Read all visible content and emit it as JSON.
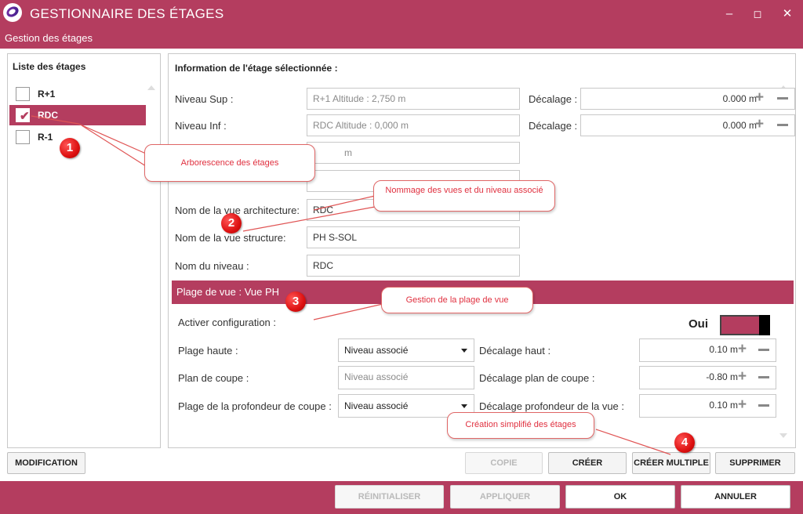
{
  "window": {
    "title": "GESTIONNAIRE DES ÉTAGES",
    "subtitle": "Gestion des étages",
    "minimize": "–",
    "maximize": "◻",
    "close": "✕"
  },
  "left_panel": {
    "title": "Liste des étages",
    "floors": [
      {
        "label": "R+1",
        "checked": false,
        "selected": false
      },
      {
        "label": "RDC",
        "checked": true,
        "selected": true
      },
      {
        "label": "R-1",
        "checked": false,
        "selected": false
      }
    ],
    "checkmark": "✔"
  },
  "info": {
    "title": "Information de l'étage sélectionnée :",
    "niveau_sup_label": "Niveau Sup :",
    "niveau_sup_value": "R+1  Altitude : 2,750 m",
    "decalage_label": "Décalage :",
    "decalage_sup_value": "0.000 m",
    "niveau_inf_label": "Niveau Inf :",
    "niveau_inf_value": "RDC  Altitude : 0,000 m",
    "decalage_inf_value": "0.000 m",
    "hidden_field_value": "m",
    "vue_archi_label": "Nom de la vue architecture:",
    "vue_archi_value": "RDC",
    "vue_structure_label": "Nom de la vue structure:",
    "vue_structure_value": "PH S-SOL",
    "niveau_label": "Nom du niveau :",
    "niveau_value": "RDC"
  },
  "plage": {
    "header": "Plage de vue : Vue PH",
    "activer_label": "Activer configuration :",
    "toggle_label": "Oui",
    "plage_haute_label": "Plage haute :",
    "plage_haute_value": "Niveau associé",
    "plan_coupe_label": "Plan de coupe :",
    "plan_coupe_value": "Niveau associé",
    "profondeur_label": "Plage de la profondeur de coupe :",
    "profondeur_value": "Niveau associé",
    "decalage_haut_label": "Décalage haut :",
    "decalage_haut_value": "0.10 m",
    "decalage_plan_label": "Décalage plan de coupe :",
    "decalage_plan_value": "-0.80 m",
    "decalage_prof_label": "Décalage profondeur de la vue :",
    "decalage_prof_value": "0.10 m"
  },
  "actions": {
    "modification": "MODIFICATION",
    "copie": "COPIE",
    "creer": "CRÉER",
    "creer_multiple": "CRÉER MULTIPLE",
    "supprimer": "SUPPRIMER"
  },
  "footer": {
    "reinitialiser": "RÉINITIALISER",
    "appliquer": "APPLIQUER",
    "ok": "OK",
    "annuler": "ANNULER"
  },
  "annotations": {
    "callout_1": "Arborescence des étages",
    "callout_2": "Nommage des vues et du niveau associé",
    "callout_3": "Gestion de la plage de vue",
    "callout_4": "Création simplifié des étages",
    "marker_1": "1",
    "marker_2": "2",
    "marker_3": "3",
    "marker_4": "4"
  },
  "icons": {
    "plus": "+",
    "logo": "app-logo-icon"
  },
  "colors": {
    "accent": "#b43d5f",
    "annotation_red": "#e0303f"
  }
}
